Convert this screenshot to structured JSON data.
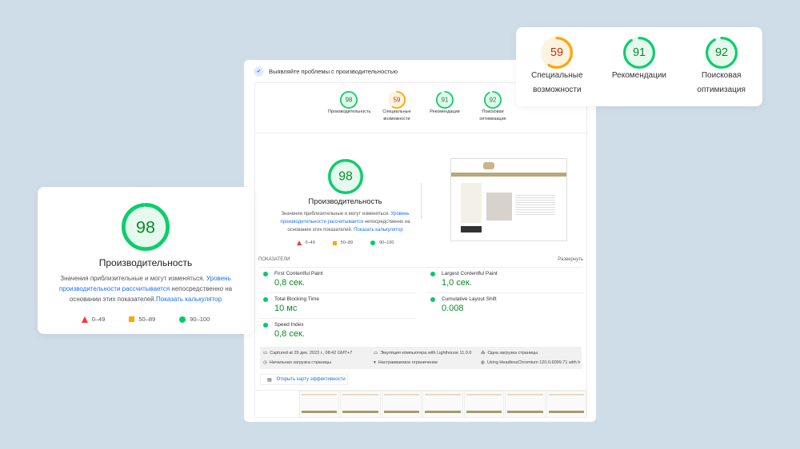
{
  "header": {
    "title": "Выявляйте проблемы с производительностью"
  },
  "colors": {
    "good": "#0cce6b",
    "average": "#ffa400",
    "bad": "#ff4e42"
  },
  "categories": [
    {
      "score": 98,
      "label": "Производительность"
    },
    {
      "score": 59,
      "label": "Специальные возможности"
    },
    {
      "score": 91,
      "label": "Рекомендации"
    },
    {
      "score": 92,
      "label": "Поисковая оптимизация"
    }
  ],
  "performance": {
    "score": 98,
    "title": "Производительность",
    "desc1": "Значения приблизительные и могут изменяться.",
    "link1": "Уровень производительности рассчитывается",
    "desc2": "непосредственно на основании этих показателей.",
    "link2": "Показать калькулятор"
  },
  "legend": {
    "bad": "0–49",
    "average": "50–89",
    "good": "90–100"
  },
  "metrics": {
    "heading": "ПОКАЗАТЕЛИ",
    "expand": "Развернуть",
    "items": [
      {
        "name": "First Contentful Paint",
        "value": "0,8 сек."
      },
      {
        "name": "Largest Contentful Paint",
        "value": "1,0 сек."
      },
      {
        "name": "Total Blocking Time",
        "value": "10 мс"
      },
      {
        "name": "Cumulative Layout Shift",
        "value": "0.008"
      },
      {
        "name": "Speed Index",
        "value": "0,8 сек."
      }
    ]
  },
  "info": [
    "Captured at 29 дек. 2023 г., 08:42 GMT+7",
    "Эмуляция компьютера with Lighthouse 11.0.0",
    "Одна загрузка страницы",
    "Начальная загрузка страницы",
    "Настраиваемое ограничение",
    "Using HeadlessChromium 120.0.6099.71 with lr"
  ],
  "treemap": "Открыть карту эффективности"
}
